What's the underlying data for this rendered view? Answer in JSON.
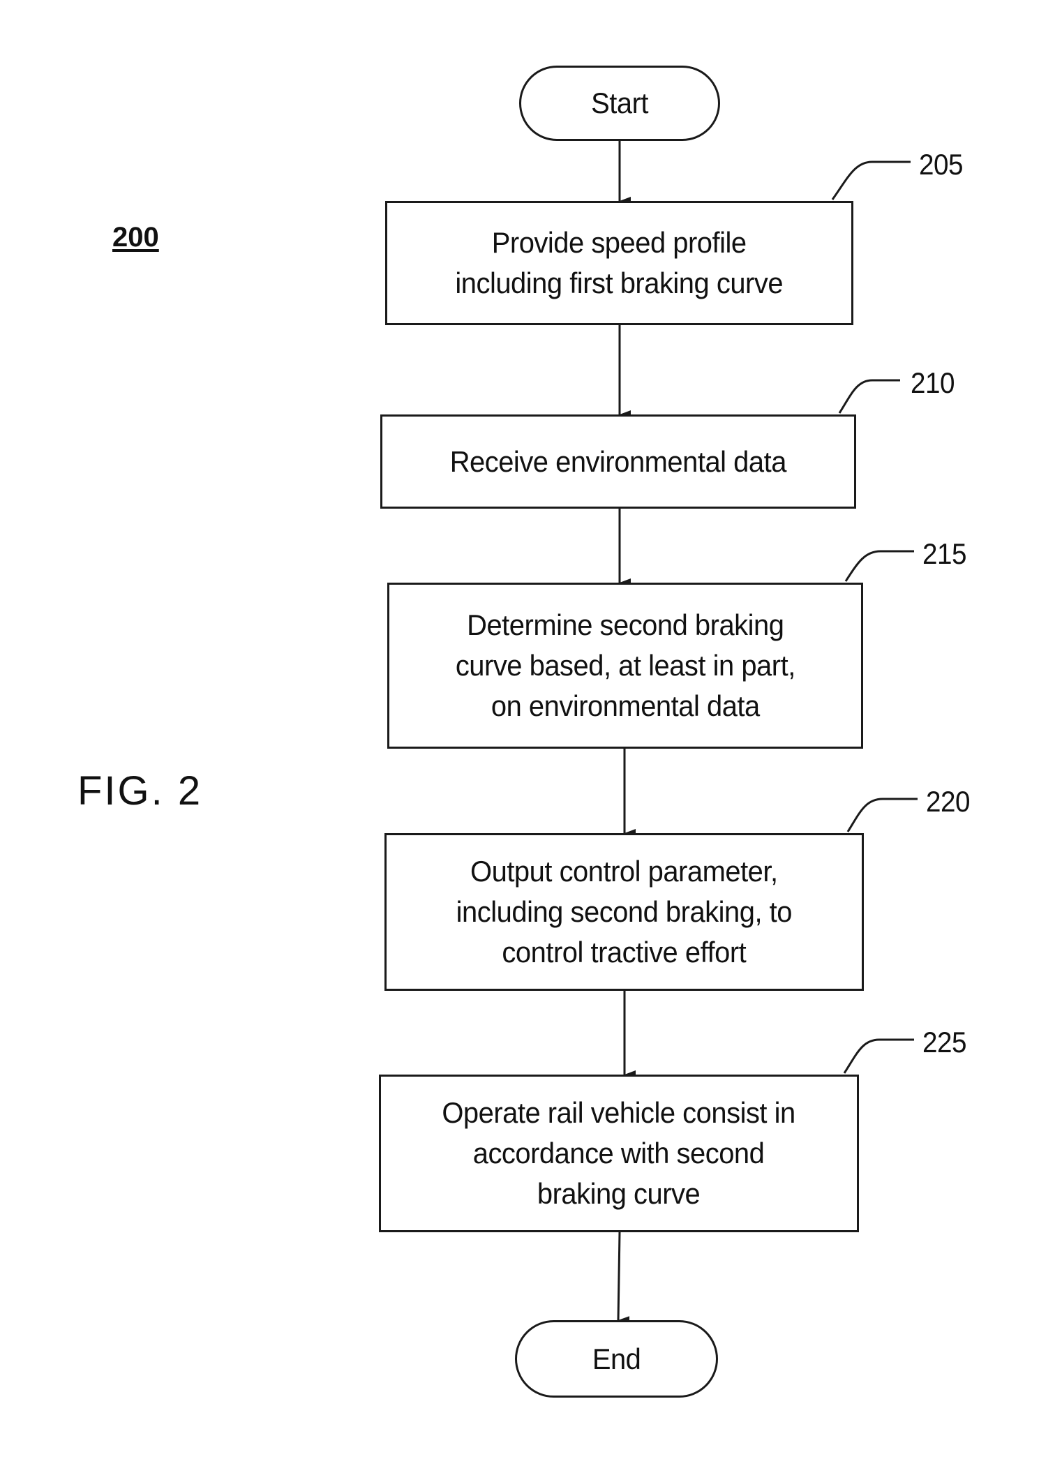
{
  "figure": {
    "number": "200",
    "title": "FIG. 2"
  },
  "nodes": [
    {
      "id": "start",
      "type": "terminal",
      "label": "Start"
    },
    {
      "id": "205",
      "type": "process",
      "ref": "205",
      "label": "Provide speed profile\nincluding first braking curve"
    },
    {
      "id": "210",
      "type": "process",
      "ref": "210",
      "label": "Receive environmental data"
    },
    {
      "id": "215",
      "type": "process",
      "ref": "215",
      "label": "Determine second braking\ncurve based, at least in part,\non environmental data"
    },
    {
      "id": "220",
      "type": "process",
      "ref": "220",
      "label": "Output control parameter,\nincluding second braking, to\ncontrol tractive effort"
    },
    {
      "id": "225",
      "type": "process",
      "ref": "225",
      "label": "Operate rail vehicle consist in\naccordance with second\nbraking curve"
    },
    {
      "id": "end",
      "type": "terminal",
      "label": "End"
    }
  ],
  "edges": [
    {
      "from": "start",
      "to": "205"
    },
    {
      "from": "205",
      "to": "210"
    },
    {
      "from": "210",
      "to": "215"
    },
    {
      "from": "215",
      "to": "220"
    },
    {
      "from": "220",
      "to": "225"
    },
    {
      "from": "225",
      "to": "end"
    }
  ]
}
